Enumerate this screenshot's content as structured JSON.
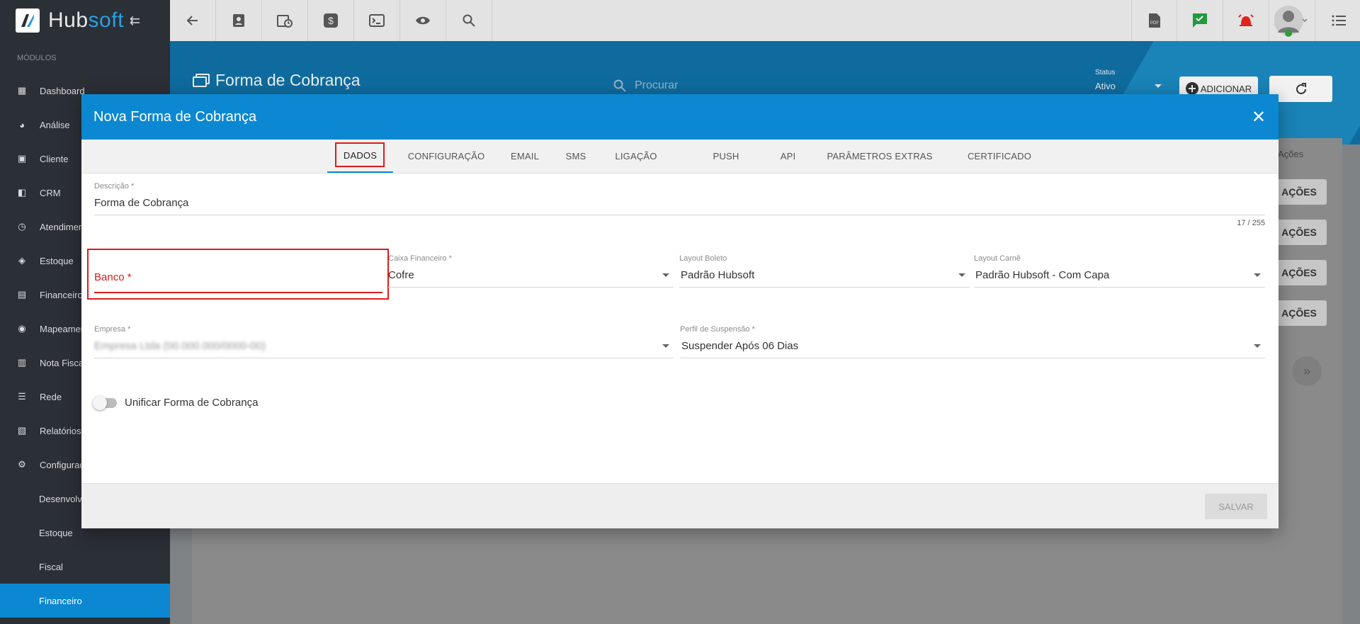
{
  "app": {
    "brand_a": "Hub",
    "brand_b": "soft"
  },
  "toolbar": {
    "icons": [
      "back-arrow-icon",
      "contact-card-icon",
      "calendar-clock-icon",
      "dollar-icon",
      "terminal-icon",
      "eye-icon",
      "search-icon"
    ],
    "right_icons": [
      "pdf-icon",
      "chat-check-icon",
      "alarm-bell-icon",
      "user-avatar-icon",
      "list-menu-icon"
    ]
  },
  "sidebar": {
    "section": "MÓDULOS",
    "items": [
      {
        "label": "Dashboard"
      },
      {
        "label": "Análise"
      },
      {
        "label": "Cliente"
      },
      {
        "label": "CRM"
      },
      {
        "label": "Atendimento"
      },
      {
        "label": "Estoque"
      },
      {
        "label": "Financeiro"
      },
      {
        "label": "Mapeamento"
      },
      {
        "label": "Nota Fiscal"
      },
      {
        "label": "Rede"
      },
      {
        "label": "Relatórios"
      },
      {
        "label": "Configurações"
      }
    ],
    "subitems": [
      {
        "label": "Desenvolvimento"
      },
      {
        "label": "Estoque"
      },
      {
        "label": "Fiscal"
      },
      {
        "label": "Financeiro"
      }
    ]
  },
  "page": {
    "title": "Forma de Cobrança",
    "search_placeholder": "Procurar",
    "status_label": "Status",
    "status_value": "Ativo",
    "add_label": "ADICIONAR",
    "actions_header": "Ações",
    "row_action": "AÇÕES"
  },
  "modal": {
    "title": "Nova Forma de Cobrança",
    "tabs": [
      "DADOS",
      "CONFIGURAÇÃO",
      "EMAIL",
      "SMS",
      "LIGAÇÃO",
      "PUSH",
      "API",
      "PARÂMETROS EXTRAS",
      "CERTIFICADO"
    ],
    "descricao": {
      "label": "Descrição *",
      "value": "Forma de Cobrança",
      "counter": "17 / 255"
    },
    "banco": {
      "label": "Banco *",
      "value": ""
    },
    "caixa": {
      "label": "Caixa Financeiro *",
      "value": "Cofre"
    },
    "layout_boleto": {
      "label": "Layout Boleto",
      "value": "Padrão Hubsoft"
    },
    "layout_carne": {
      "label": "Layout Carnê",
      "value": "Padrão Hubsoft - Com Capa"
    },
    "empresa": {
      "label": "Empresa *",
      "value": "Empresa Ltda (00.000.000/0000-00)"
    },
    "perfil": {
      "label": "Perfil de Suspensão *",
      "value": "Suspender Após 06 Dias"
    },
    "unificar_label": "Unificar Forma de Cobrança",
    "save_label": "SALVAR"
  },
  "colors": {
    "primary": "#0b88d1",
    "sidebar": "#2b2f36",
    "highlight": "#e01b1b"
  }
}
